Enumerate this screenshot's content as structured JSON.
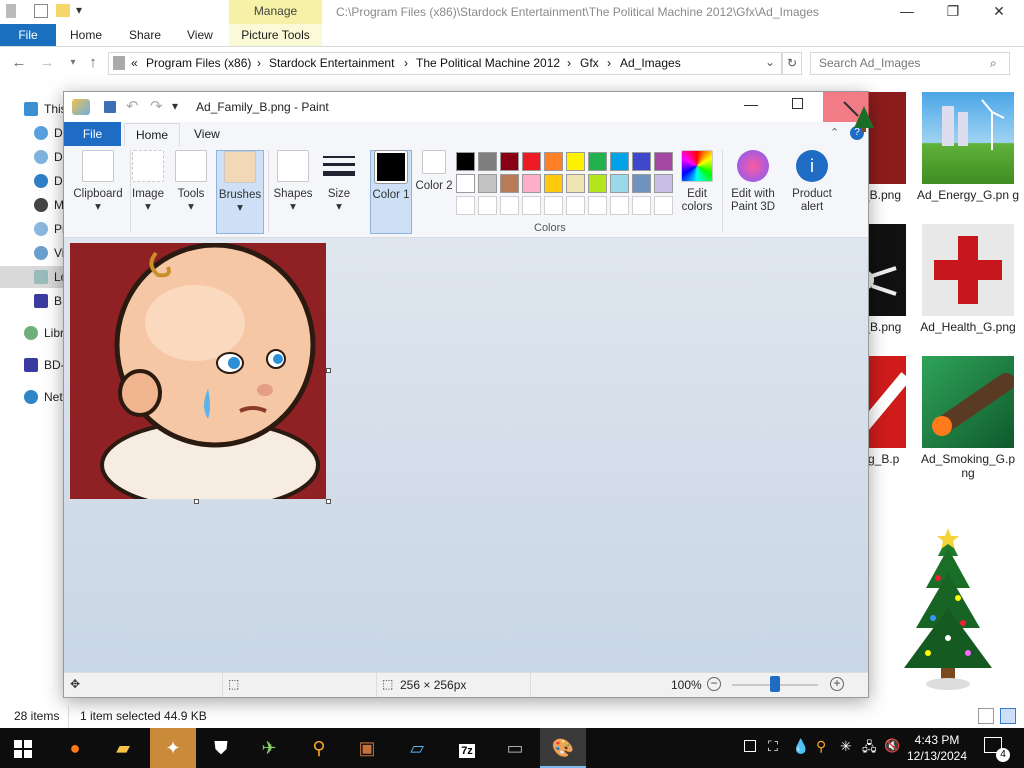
{
  "explorer": {
    "manage_label": "Manage",
    "title_path": "C:\\Program Files (x86)\\Stardock Entertainment\\The Political Machine 2012\\Gfx\\Ad_Images",
    "tabs": [
      "File",
      "Home",
      "Share",
      "View",
      "Picture Tools"
    ],
    "breadcrumb": [
      "«",
      "Program Files (x86)",
      "›",
      "Stardock Entertainment",
      "›",
      "The Political Machine 2012",
      "›",
      "Gfx",
      "›",
      "Ad_Images"
    ],
    "search_placeholder": "Search Ad_Images",
    "nav_items": [
      "This",
      "De",
      "Do",
      "Do",
      "Mu",
      "Pic",
      "Vid",
      "Lo",
      "BD",
      "Libr",
      "BD-",
      "Net"
    ],
    "files": [
      {
        "label": "y_B.png"
      },
      {
        "label": "Ad_Energy_G.pn g"
      },
      {
        "label": "h_B.png"
      },
      {
        "label": "Ad_Health_G.png"
      },
      {
        "label": "ing_B.p"
      },
      {
        "label": "Ad_Smoking_G.p ng"
      }
    ],
    "status": {
      "count": "28 items",
      "selected": "1 item selected  44.9 KB"
    }
  },
  "paint": {
    "title": "Ad_Family_B.png - Paint",
    "tabs": [
      "File",
      "Home",
      "View"
    ],
    "ribbon": {
      "clipboard": "Clipboard",
      "image": "Image",
      "tools": "Tools",
      "brushes": "Brushes",
      "shapes": "Shapes",
      "size": "Size",
      "color1": "Color 1",
      "color2": "Color 2",
      "edit_colors": "Edit colors",
      "edit_paint3d": "Edit with Paint 3D",
      "product_alert": "Product alert",
      "colors_group": "Colors"
    },
    "palette_row1": [
      "#000000",
      "#7f7f7f",
      "#880015",
      "#ed1c24",
      "#ff7f27",
      "#fff200",
      "#22b14c",
      "#00a2e8",
      "#3f48cc",
      "#a349a4"
    ],
    "palette_row2": [
      "#ffffff",
      "#c3c3c3",
      "#b97a57",
      "#ffaec9",
      "#ffc90e",
      "#efe4b0",
      "#b5e61d",
      "#99d9ea",
      "#7092be",
      "#c8bfe7"
    ],
    "status": {
      "dimensions": "256 × 256px",
      "zoom": "100%"
    }
  },
  "taskbar": {
    "time": "4:43 PM",
    "date": "12/13/2024",
    "notification_count": "4"
  }
}
